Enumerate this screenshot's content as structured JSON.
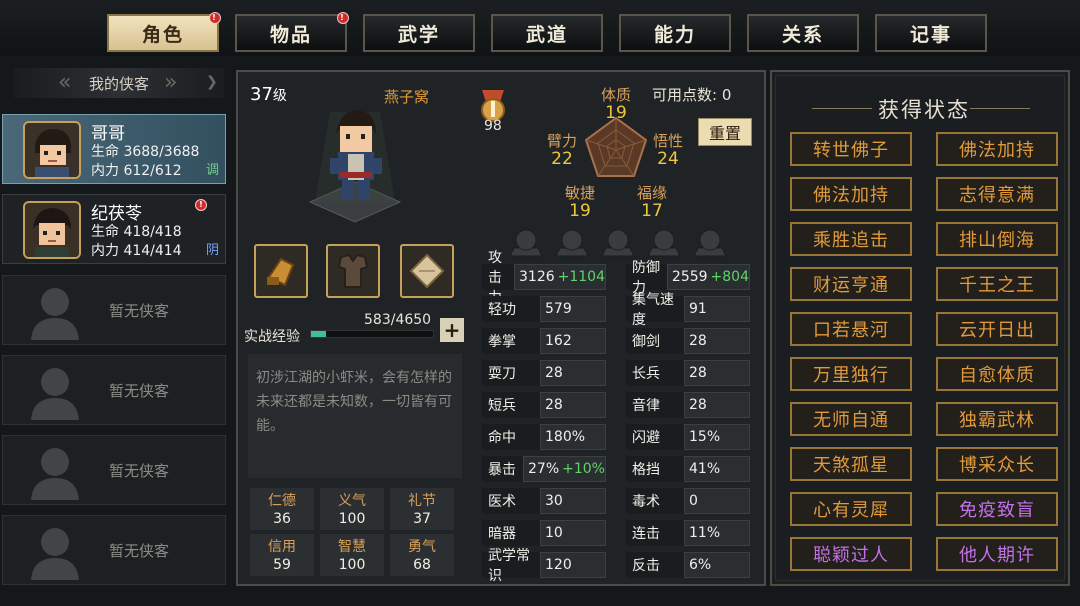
{
  "tabs": [
    {
      "label": "角色",
      "active": true,
      "badge": "!"
    },
    {
      "label": "物品",
      "active": false,
      "badge": "!"
    },
    {
      "label": "武学",
      "active": false,
      "badge": ""
    },
    {
      "label": "武道",
      "active": false,
      "badge": ""
    },
    {
      "label": "能力",
      "active": false,
      "badge": ""
    },
    {
      "label": "关系",
      "active": false,
      "badge": ""
    },
    {
      "label": "记事",
      "active": false,
      "badge": ""
    }
  ],
  "sidebar": {
    "title": "我的侠客",
    "heroes": [
      {
        "name": "哥哥",
        "hp": "生命 3688/3688",
        "mp": "内力 612/612",
        "tag": "调",
        "tag_color": "#6fd38a"
      },
      {
        "name": "纪茯苓",
        "hp": "生命 418/418",
        "mp": "内力 414/414",
        "tag": "阴",
        "tag_color": "#7aa2ff",
        "badge": "!"
      }
    ],
    "empty_label": "暂无侠客"
  },
  "character": {
    "level_num": "37",
    "level_unit": "级",
    "title": "燕子窝",
    "medal_value": "98",
    "exp_label": "实战经验",
    "exp_value": "583/4650",
    "exp_fraction": 0.125,
    "plus": "+",
    "description": "初涉江湖的小虾米，会有怎样的未来还都是未知数，一切皆有可能。"
  },
  "attributes": {
    "points_label": "可用点数:",
    "points_value": "0",
    "reset_label": "重置",
    "tizhi": {
      "label": "体质",
      "value": "19"
    },
    "bili": {
      "label": "臂力",
      "value": "22"
    },
    "wuxing": {
      "label": "悟性",
      "value": "24"
    },
    "minjie": {
      "label": "敏捷",
      "value": "19"
    },
    "fuyuan": {
      "label": "福缘",
      "value": "17"
    }
  },
  "stats_left": [
    {
      "label": "攻击力",
      "value": "3126",
      "bonus": "+1104"
    },
    {
      "label": "轻功",
      "value": "579",
      "bonus": ""
    },
    {
      "label": "拳掌",
      "value": "162",
      "bonus": ""
    },
    {
      "label": "耍刀",
      "value": "28",
      "bonus": ""
    },
    {
      "label": "短兵",
      "value": "28",
      "bonus": ""
    },
    {
      "label": "命中",
      "value": "180%",
      "bonus": ""
    },
    {
      "label": "暴击",
      "value": "27%",
      "bonus": "+10%"
    },
    {
      "label": "医术",
      "value": "30",
      "bonus": ""
    },
    {
      "label": "暗器",
      "value": "10",
      "bonus": ""
    },
    {
      "label": "武学常识",
      "value": "120",
      "bonus": ""
    }
  ],
  "stats_right": [
    {
      "label": "防御力",
      "value": "2559",
      "bonus": "+804"
    },
    {
      "label": "集气速度",
      "value": "91",
      "bonus": ""
    },
    {
      "label": "御剑",
      "value": "28",
      "bonus": ""
    },
    {
      "label": "长兵",
      "value": "28",
      "bonus": ""
    },
    {
      "label": "音律",
      "value": "28",
      "bonus": ""
    },
    {
      "label": "闪避",
      "value": "15%",
      "bonus": ""
    },
    {
      "label": "格挡",
      "value": "41%",
      "bonus": ""
    },
    {
      "label": "毒术",
      "value": "0",
      "bonus": ""
    },
    {
      "label": "连击",
      "value": "11%",
      "bonus": ""
    },
    {
      "label": "反击",
      "value": "6%",
      "bonus": ""
    }
  ],
  "virtues": [
    {
      "label": "仁德",
      "value": "36"
    },
    {
      "label": "义气",
      "value": "100"
    },
    {
      "label": "礼节",
      "value": "37"
    },
    {
      "label": "信用",
      "value": "59"
    },
    {
      "label": "智慧",
      "value": "100"
    },
    {
      "label": "勇气",
      "value": "68"
    }
  ],
  "status_panel": {
    "title": "获得状态",
    "items": [
      {
        "label": "转世佛子",
        "color": "gold"
      },
      {
        "label": "佛法加持",
        "color": "gold"
      },
      {
        "label": "佛法加持",
        "color": "gold"
      },
      {
        "label": "志得意满",
        "color": "gold"
      },
      {
        "label": "乘胜追击",
        "color": "gold"
      },
      {
        "label": "排山倒海",
        "color": "gold"
      },
      {
        "label": "财运亨通",
        "color": "gold"
      },
      {
        "label": "千王之王",
        "color": "gold"
      },
      {
        "label": "口若悬河",
        "color": "gold"
      },
      {
        "label": "云开日出",
        "color": "gold"
      },
      {
        "label": "万里独行",
        "color": "gold"
      },
      {
        "label": "自愈体质",
        "color": "gold"
      },
      {
        "label": "无师自通",
        "color": "gold"
      },
      {
        "label": "独霸武林",
        "color": "gold"
      },
      {
        "label": "天煞孤星",
        "color": "gold"
      },
      {
        "label": "博采众长",
        "color": "gold"
      },
      {
        "label": "心有灵犀",
        "color": "gold"
      },
      {
        "label": "免疫致盲",
        "color": "purple"
      },
      {
        "label": "聪颖过人",
        "color": "purple"
      },
      {
        "label": "他人期许",
        "color": "purple"
      }
    ]
  }
}
